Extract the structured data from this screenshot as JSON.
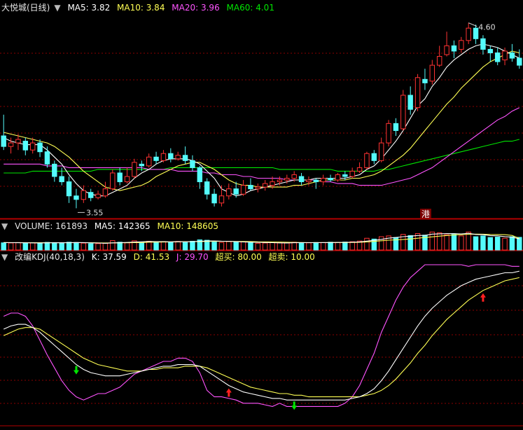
{
  "price_panel": {
    "title": "大悦城(日线)",
    "ma5": "MA5: 3.82",
    "ma10": "MA10: 3.84",
    "ma20": "MA20: 3.96",
    "ma60": "MA60: 4.01",
    "high_label": "4.60",
    "low_label": "3.55",
    "marker": "港"
  },
  "volume_panel": {
    "vol": "VOLUME: 161893",
    "ma5": "MA5: 142365",
    "ma10": "MA10: 148605"
  },
  "kdj_panel": {
    "title": "改编KDJ(40,18,3)",
    "k": "K: 37.59",
    "d": "D: 41.53",
    "j": "J: 29.70",
    "overbought": "超买: 80.00",
    "oversold": "超卖: 10.00"
  },
  "colors": {
    "up": "#ff3232",
    "down": "#54fcfc",
    "ma5": "#ffffff",
    "ma10": "#ffff54",
    "ma20": "#ff54ff",
    "ma60": "#00e600",
    "grid": "#8b0000",
    "ind_white": "#ffffff",
    "ind_yellow": "#ffff54",
    "ind_magenta": "#ff54ff"
  },
  "chart_data": {
    "type": "candlestick",
    "price_range": [
      3.5,
      4.65
    ],
    "candles": [
      [
        3.96,
        3.9,
        4.08,
        3.88
      ],
      [
        3.9,
        3.92,
        3.95,
        3.86
      ],
      [
        3.92,
        3.94,
        3.97,
        3.88
      ],
      [
        3.93,
        3.88,
        3.95,
        3.85
      ],
      [
        3.88,
        3.92,
        3.95,
        3.86
      ],
      [
        3.92,
        3.87,
        3.94,
        3.84
      ],
      [
        3.87,
        3.8,
        3.9,
        3.78
      ],
      [
        3.8,
        3.73,
        3.82,
        3.7
      ],
      [
        3.73,
        3.7,
        3.78,
        3.68
      ],
      [
        3.7,
        3.62,
        3.73,
        3.58
      ],
      [
        3.62,
        3.6,
        3.66,
        3.55
      ],
      [
        3.6,
        3.65,
        3.68,
        3.58
      ],
      [
        3.64,
        3.61,
        3.66,
        3.59
      ],
      [
        3.61,
        3.63,
        3.65,
        3.6
      ],
      [
        3.62,
        3.66,
        3.7,
        3.61
      ],
      [
        3.66,
        3.75,
        3.77,
        3.65
      ],
      [
        3.75,
        3.7,
        3.78,
        3.68
      ],
      [
        3.7,
        3.73,
        3.78,
        3.69
      ],
      [
        3.73,
        3.81,
        3.83,
        3.72
      ],
      [
        3.8,
        3.79,
        3.82,
        3.76
      ],
      [
        3.79,
        3.84,
        3.86,
        3.78
      ],
      [
        3.84,
        3.82,
        3.87,
        3.8
      ],
      [
        3.82,
        3.86,
        3.88,
        3.81
      ],
      [
        3.86,
        3.83,
        3.89,
        3.81
      ],
      [
        3.83,
        3.85,
        3.87,
        3.82
      ],
      [
        3.85,
        3.82,
        3.9,
        3.8
      ],
      [
        3.82,
        3.78,
        3.85,
        3.76
      ],
      [
        3.78,
        3.7,
        3.79,
        3.66
      ],
      [
        3.7,
        3.63,
        3.72,
        3.6
      ],
      [
        3.63,
        3.58,
        3.66,
        3.56
      ],
      [
        3.58,
        3.62,
        3.68,
        3.56
      ],
      [
        3.62,
        3.66,
        3.69,
        3.6
      ],
      [
        3.66,
        3.63,
        3.7,
        3.61
      ],
      [
        3.63,
        3.68,
        3.71,
        3.62
      ],
      [
        3.68,
        3.66,
        3.72,
        3.65
      ],
      [
        3.66,
        3.67,
        3.69,
        3.64
      ],
      [
        3.67,
        3.69,
        3.71,
        3.65
      ],
      [
        3.68,
        3.7,
        3.73,
        3.66
      ],
      [
        3.7,
        3.71,
        3.73,
        3.68
      ],
      [
        3.71,
        3.72,
        3.74,
        3.69
      ],
      [
        3.72,
        3.74,
        3.76,
        3.7
      ],
      [
        3.73,
        3.7,
        3.75,
        3.68
      ],
      [
        3.7,
        3.71,
        3.73,
        3.68
      ],
      [
        3.71,
        3.7,
        3.72,
        3.66
      ],
      [
        3.7,
        3.72,
        3.74,
        3.68
      ],
      [
        3.72,
        3.71,
        3.74,
        3.7
      ],
      [
        3.71,
        3.74,
        3.75,
        3.7
      ],
      [
        3.74,
        3.73,
        3.76,
        3.71
      ],
      [
        3.73,
        3.76,
        3.78,
        3.72
      ],
      [
        3.76,
        3.78,
        3.81,
        3.75
      ],
      [
        3.78,
        3.86,
        3.87,
        3.77
      ],
      [
        3.86,
        3.82,
        3.88,
        3.8
      ],
      [
        3.82,
        3.92,
        3.95,
        3.81
      ],
      [
        3.92,
        4.03,
        4.05,
        3.9
      ],
      [
        4.03,
        3.99,
        4.06,
        3.96
      ],
      [
        4.0,
        4.19,
        4.22,
        3.99
      ],
      [
        4.19,
        4.11,
        4.24,
        4.08
      ],
      [
        4.12,
        4.29,
        4.31,
        4.1
      ],
      [
        4.28,
        4.26,
        4.34,
        4.22
      ],
      [
        4.27,
        4.36,
        4.39,
        4.25
      ],
      [
        4.36,
        4.41,
        4.47,
        4.35
      ],
      [
        4.42,
        4.47,
        4.55,
        4.41
      ],
      [
        4.47,
        4.44,
        4.5,
        4.4
      ],
      [
        4.45,
        4.5,
        4.52,
        4.43
      ],
      [
        4.5,
        4.57,
        4.6,
        4.48
      ],
      [
        4.57,
        4.51,
        4.59,
        4.48
      ],
      [
        4.51,
        4.45,
        4.53,
        4.42
      ],
      [
        4.45,
        4.43,
        4.47,
        4.38
      ],
      [
        4.43,
        4.38,
        4.46,
        4.36
      ],
      [
        4.39,
        4.44,
        4.46,
        4.36
      ],
      [
        4.43,
        4.4,
        4.48,
        4.38
      ],
      [
        4.4,
        4.36,
        4.45,
        4.34
      ]
    ],
    "ma5": [
      3.95,
      3.93,
      3.92,
      3.91,
      3.91,
      3.91,
      3.88,
      3.84,
      3.8,
      3.74,
      3.69,
      3.65,
      3.63,
      3.62,
      3.62,
      3.64,
      3.66,
      3.68,
      3.72,
      3.75,
      3.77,
      3.8,
      3.82,
      3.83,
      3.83,
      3.83,
      3.82,
      3.8,
      3.76,
      3.72,
      3.66,
      3.64,
      3.62,
      3.63,
      3.65,
      3.66,
      3.67,
      3.68,
      3.69,
      3.7,
      3.71,
      3.71,
      3.71,
      3.72,
      3.72,
      3.72,
      3.72,
      3.72,
      3.73,
      3.74,
      3.77,
      3.79,
      3.83,
      3.88,
      3.93,
      3.99,
      4.06,
      4.13,
      4.17,
      4.24,
      4.29,
      4.35,
      4.39,
      4.42,
      4.45,
      4.47,
      4.48,
      4.47,
      4.46,
      4.44,
      4.42,
      4.4
    ],
    "ma10": [
      3.98,
      3.97,
      3.96,
      3.95,
      3.94,
      3.93,
      3.92,
      3.9,
      3.87,
      3.84,
      3.8,
      3.76,
      3.73,
      3.7,
      3.67,
      3.66,
      3.65,
      3.66,
      3.67,
      3.68,
      3.7,
      3.73,
      3.75,
      3.77,
      3.79,
      3.8,
      3.81,
      3.81,
      3.79,
      3.77,
      3.74,
      3.71,
      3.69,
      3.68,
      3.68,
      3.67,
      3.67,
      3.67,
      3.67,
      3.67,
      3.68,
      3.68,
      3.69,
      3.7,
      3.71,
      3.71,
      3.71,
      3.71,
      3.72,
      3.72,
      3.73,
      3.74,
      3.76,
      3.79,
      3.82,
      3.85,
      3.89,
      3.94,
      3.99,
      4.04,
      4.09,
      4.14,
      4.18,
      4.23,
      4.27,
      4.31,
      4.35,
      4.38,
      4.4,
      4.42,
      4.44,
      4.43
    ],
    "ma20": [
      3.8,
      3.8,
      3.8,
      3.8,
      3.8,
      3.8,
      3.79,
      3.79,
      3.79,
      3.78,
      3.78,
      3.78,
      3.78,
      3.78,
      3.78,
      3.78,
      3.78,
      3.78,
      3.78,
      3.78,
      3.77,
      3.77,
      3.77,
      3.77,
      3.76,
      3.76,
      3.76,
      3.76,
      3.75,
      3.75,
      3.74,
      3.74,
      3.74,
      3.73,
      3.73,
      3.72,
      3.72,
      3.72,
      3.72,
      3.71,
      3.71,
      3.71,
      3.71,
      3.71,
      3.7,
      3.7,
      3.69,
      3.69,
      3.69,
      3.68,
      3.68,
      3.68,
      3.68,
      3.69,
      3.7,
      3.71,
      3.72,
      3.74,
      3.76,
      3.78,
      3.81,
      3.84,
      3.87,
      3.9,
      3.93,
      3.96,
      3.99,
      4.02,
      4.05,
      4.07,
      4.1,
      4.12
    ],
    "ma60": [
      3.75,
      3.75,
      3.75,
      3.75,
      3.76,
      3.76,
      3.76,
      3.76,
      3.76,
      3.76,
      3.76,
      3.76,
      3.76,
      3.77,
      3.77,
      3.77,
      3.77,
      3.77,
      3.77,
      3.77,
      3.77,
      3.77,
      3.77,
      3.78,
      3.78,
      3.78,
      3.78,
      3.78,
      3.78,
      3.78,
      3.78,
      3.78,
      3.78,
      3.78,
      3.78,
      3.78,
      3.78,
      3.78,
      3.77,
      3.77,
      3.77,
      3.77,
      3.77,
      3.77,
      3.77,
      3.77,
      3.76,
      3.76,
      3.76,
      3.76,
      3.76,
      3.76,
      3.77,
      3.77,
      3.78,
      3.79,
      3.8,
      3.81,
      3.82,
      3.83,
      3.84,
      3.85,
      3.86,
      3.87,
      3.88,
      3.89,
      3.9,
      3.91,
      3.92,
      3.93,
      3.93,
      3.94
    ],
    "volume": [
      92000,
      90000,
      95000,
      88000,
      92000,
      87000,
      98000,
      95000,
      92000,
      100000,
      96000,
      88000,
      80000,
      82000,
      85000,
      120000,
      100000,
      92000,
      118000,
      96000,
      112000,
      100000,
      108000,
      98000,
      110000,
      95000,
      112000,
      130000,
      125000,
      102000,
      96000,
      108000,
      98000,
      104000,
      92000,
      86000,
      90000,
      94000,
      92000,
      90000,
      100000,
      94000,
      92000,
      96000,
      95000,
      100000,
      98000,
      102000,
      106000,
      115000,
      150000,
      140000,
      170000,
      180000,
      160000,
      200000,
      185000,
      210000,
      190000,
      230000,
      220000,
      195000,
      200000,
      180000,
      230000,
      170000,
      180000,
      160000,
      165000,
      150000,
      170000,
      161893
    ],
    "vol_ma5": [
      95000,
      94000,
      93000,
      92000,
      91000,
      90000,
      92000,
      93000,
      93000,
      94000,
      96000,
      95000,
      91000,
      89000,
      86000,
      91000,
      93000,
      97000,
      101000,
      105000,
      109000,
      107000,
      107000,
      105000,
      106000,
      105000,
      106000,
      112000,
      115000,
      116000,
      113000,
      112000,
      106000,
      103000,
      100000,
      98000,
      96000,
      94000,
      91000,
      90000,
      93000,
      94000,
      94000,
      94000,
      95000,
      95000,
      97000,
      98000,
      100000,
      104000,
      114000,
      123000,
      136000,
      151000,
      160000,
      170000,
      177000,
      185000,
      187000,
      203000,
      207000,
      209000,
      209000,
      205000,
      213000,
      199000,
      196000,
      184000,
      181000,
      171000,
      165000,
      142365
    ],
    "vol_ma10": [
      96000,
      95000,
      95000,
      94000,
      94000,
      93000,
      93000,
      93000,
      93000,
      93000,
      94000,
      94000,
      93000,
      91000,
      90000,
      91000,
      92000,
      93000,
      94000,
      96000,
      100000,
      101000,
      102000,
      103000,
      105000,
      107000,
      107000,
      108000,
      110000,
      111000,
      111000,
      110000,
      109000,
      109000,
      108000,
      105000,
      104000,
      103000,
      101000,
      99000,
      97000,
      96000,
      95000,
      95000,
      95000,
      96000,
      96000,
      96000,
      97000,
      99000,
      104000,
      110000,
      118000,
      125000,
      130000,
      135000,
      141000,
      150000,
      160000,
      168000,
      177000,
      185000,
      193000,
      196000,
      201000,
      203000,
      202000,
      199000,
      198000,
      196000,
      186000,
      148605
    ],
    "kdj_range": [
      0,
      100
    ],
    "kdj_k": [
      60,
      62,
      63,
      63,
      61,
      58,
      54,
      50,
      46,
      42,
      38,
      35,
      33,
      32,
      31,
      31,
      31,
      32,
      33,
      34,
      35,
      36,
      37,
      37,
      38,
      38,
      38,
      37,
      34,
      31,
      28,
      25,
      23,
      21,
      20,
      19,
      18,
      17,
      17,
      16,
      16,
      16,
      16,
      16,
      16,
      16,
      16,
      16,
      17,
      18,
      20,
      23,
      28,
      34,
      41,
      48,
      55,
      62,
      68,
      73,
      77,
      81,
      84,
      87,
      89,
      91,
      92,
      93,
      94,
      95,
      95,
      96
    ],
    "kdj_d": [
      56,
      58,
      60,
      61,
      61,
      60,
      57,
      54,
      51,
      48,
      45,
      42,
      40,
      38,
      37,
      36,
      35,
      34,
      34,
      34,
      35,
      35,
      36,
      36,
      36,
      37,
      37,
      37,
      36,
      34,
      32,
      30,
      28,
      26,
      24,
      23,
      22,
      21,
      20,
      20,
      19,
      19,
      18,
      18,
      18,
      18,
      18,
      18,
      18,
      18,
      19,
      20,
      22,
      25,
      29,
      34,
      39,
      45,
      50,
      56,
      61,
      66,
      70,
      74,
      78,
      81,
      84,
      86,
      88,
      90,
      91,
      92
    ],
    "kdj_j": [
      68,
      70,
      70,
      68,
      62,
      53,
      44,
      36,
      28,
      22,
      18,
      16,
      18,
      20,
      20,
      22,
      24,
      28,
      32,
      34,
      36,
      38,
      40,
      40,
      42,
      42,
      40,
      33,
      22,
      18,
      18,
      17,
      16,
      14,
      14,
      14,
      13,
      12,
      14,
      12,
      12,
      12,
      12,
      12,
      12,
      12,
      12,
      14,
      18,
      25,
      35,
      45,
      58,
      68,
      78,
      86,
      92,
      96,
      100,
      100,
      100,
      100,
      100,
      100,
      99,
      100,
      100,
      100,
      100,
      100,
      99,
      99
    ],
    "kdj_overbought": 80,
    "kdj_oversold": 10,
    "buy_signal_indices": [
      31,
      66
    ],
    "sell_signal_indices": [
      10,
      40
    ],
    "high_marker_index": 64,
    "low_marker_index": 10
  }
}
